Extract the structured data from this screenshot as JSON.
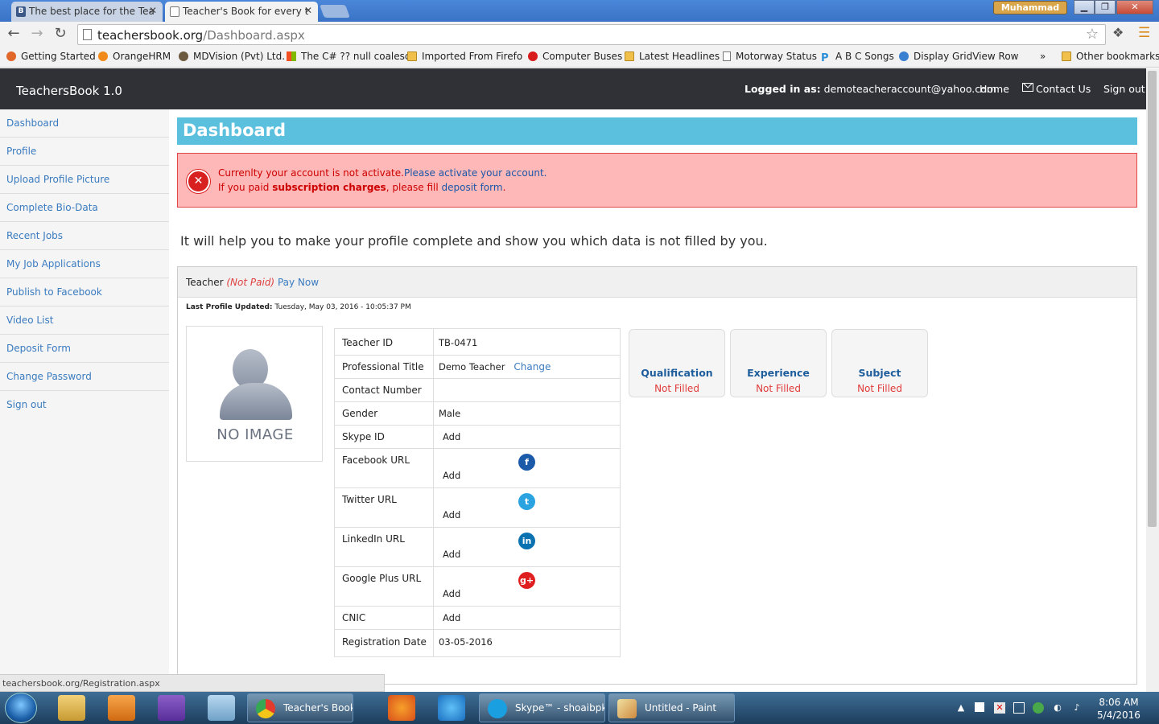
{
  "browser": {
    "tabs": [
      {
        "title": "The best place for the Tea",
        "favicon": "B"
      },
      {
        "title": "Teacher's Book for every t"
      }
    ],
    "user_badge": "Muhammad",
    "url_host": "teachersbook.org",
    "url_path": "/Dashboard.aspx",
    "bookmarks": [
      "Getting Started",
      "OrangeHRM",
      "MDVision (Pvt) Ltd.",
      "The C# ?? null coalesc",
      "Imported From Firefo",
      "Computer Buses",
      "Latest Headlines",
      "Motorway Status",
      "A B C Songs",
      "Display GridView Row"
    ],
    "bookmarks_overflow": "»",
    "other_bookmarks": "Other bookmarks",
    "status_url": "teachersbook.org/Registration.aspx"
  },
  "header": {
    "brand": "TeachersBook 1.0",
    "logged_in_label": "Logged in as:",
    "logged_in_email": "demoteacheraccount@yahoo.com",
    "nav": {
      "home": "Home",
      "contact": "Contact Us",
      "signout": "Sign out"
    }
  },
  "sidebar": {
    "items": [
      "Dashboard",
      "Profile",
      "Upload Profile Picture",
      "Complete Bio-Data",
      "Recent Jobs",
      "My Job Applications",
      "Publish to Facebook",
      "Video List",
      "Deposit Form",
      "Change Password",
      "Sign out"
    ]
  },
  "main": {
    "title": "Dashboard",
    "alert": {
      "line1_text": "Currenlty your account is not activate.",
      "line1_link": "Please activate your account.",
      "line2_prefix": "If you paid ",
      "line2_bold": "subscription charges",
      "line2_mid": ", please fill ",
      "line2_link": "deposit form",
      "line2_end": "."
    },
    "help_text": "It will help you to make your profile complete and show you which data is not filled by you.",
    "panel": {
      "role": "Teacher",
      "status": "(Not Paid)",
      "pay_now": "Pay Now",
      "last_updated_label": "Last Profile Updated:",
      "last_updated_value": "Tuesday, May 03, 2016 - 10:05:37 PM",
      "no_image": "NO IMAGE",
      "rows": {
        "teacher_id": {
          "label": "Teacher ID",
          "value": "TB-0471"
        },
        "professional_title": {
          "label": "Professional Title",
          "value": "Demo Teacher",
          "action": "Change"
        },
        "contact_number": {
          "label": "Contact Number",
          "value": ""
        },
        "gender": {
          "label": "Gender",
          "value": "Male"
        },
        "skype_id": {
          "label": "Skype ID",
          "action": "Add"
        },
        "facebook_url": {
          "label": "Facebook URL",
          "action": "Add",
          "icon": "f"
        },
        "twitter_url": {
          "label": "Twitter URL",
          "action": "Add",
          "icon": "t"
        },
        "linkedin_url": {
          "label": "LinkedIn URL",
          "action": "Add",
          "icon": "in"
        },
        "googleplus_url": {
          "label": "Google Plus URL",
          "action": "Add",
          "icon": "g+"
        },
        "cnic": {
          "label": "CNIC",
          "action": "Add"
        },
        "registration_date": {
          "label": "Registration Date",
          "value": "03-05-2016"
        }
      },
      "cards": [
        {
          "title": "Qualification",
          "status": "Not Filled"
        },
        {
          "title": "Experience",
          "status": "Not Filled"
        },
        {
          "title": "Subject",
          "status": "Not Filled"
        }
      ]
    }
  },
  "taskbar": {
    "tasks": [
      {
        "label": "Teacher's Book fo..."
      },
      {
        "label": "Skype™ - shoaibpk"
      },
      {
        "label": "Untitled - Paint"
      }
    ],
    "time": "8:06 AM",
    "date": "5/4/2016"
  },
  "colors": {
    "header_bg": "#2f3137",
    "title_bar": "#5bc0de",
    "alert_bg": "#ffb8b8",
    "link": "#3a7bbf",
    "facebook": "#1a5aa8",
    "twitter": "#2aa3e0",
    "linkedin": "#0a72b0",
    "googleplus": "#e02020"
  }
}
